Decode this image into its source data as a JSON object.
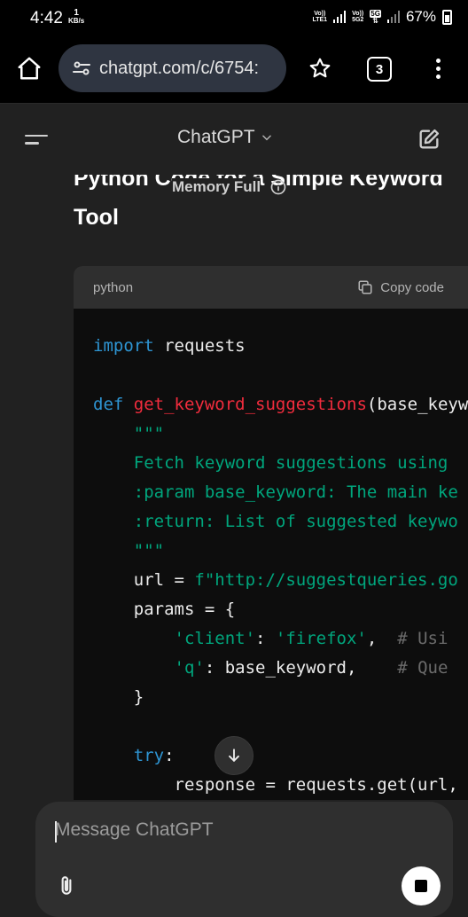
{
  "status_bar": {
    "time": "4:42",
    "speed_value": "1",
    "speed_unit": "KB/s",
    "net1_top": "Vo))",
    "net1_bottom": "LTE1",
    "net2_top": "Vo))",
    "net2_bottom": "5G2",
    "network_type": "5G",
    "battery": "67%"
  },
  "browser": {
    "url": "chatgpt.com/c/6754:",
    "tab_count": "3"
  },
  "chat_header": {
    "title": "ChatGPT"
  },
  "banner": {
    "memory_label": "Memory Full"
  },
  "message": {
    "heading": "Python Code for a Simple Keyword Tool"
  },
  "code_block": {
    "language": "python",
    "copy_label": "Copy code",
    "lines": {
      "l1_kw": "import",
      "l1_rest": " requests",
      "l3_kw": "def",
      "l3_fn": "get_keyword_suggestions",
      "l3_rest": "(base_keyword",
      "l4": "    \"\"\"",
      "l5": "    Fetch keyword suggestions using",
      "l6": "    :param base_keyword: The main ke",
      "l7": "    :return: List of suggested keywo",
      "l8": "    \"\"\"",
      "l9_a": "    url = ",
      "l9_b": "f\"http://suggestqueries.go",
      "l10": "    params = {",
      "l11_ind": "        ",
      "l11_a": "'client'",
      "l11_b": ": ",
      "l11_c": "'firefox'",
      "l11_d": ",  ",
      "l11_cm": "# Usi",
      "l12_ind": "        ",
      "l12_a": "'q'",
      "l12_b": ": base_keyword,    ",
      "l12_cm": "# Que",
      "l13": "    }",
      "l15_ind": "    ",
      "l15_kw": "try",
      "l15_rest": ":",
      "l16": "        response = requests.get(url,"
    }
  },
  "composer": {
    "placeholder": "Message ChatGPT"
  }
}
